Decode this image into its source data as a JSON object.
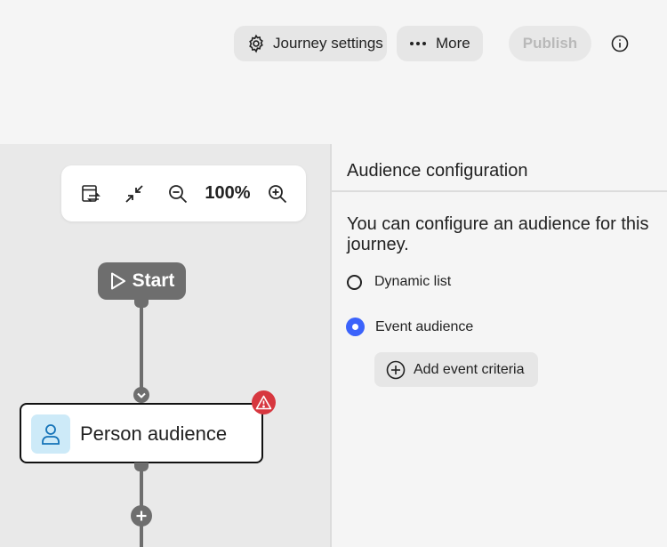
{
  "header": {
    "journey_settings_label": "Journey settings",
    "more_label": "More",
    "publish_label": "Publish",
    "icons": [
      "gear-icon",
      "ellipsis-icon",
      "info-icon"
    ]
  },
  "canvas": {
    "zoom_level": "100%",
    "toolbar_icons": [
      "switch-view-icon",
      "collapse-icon",
      "zoom-out-icon",
      "zoom-in-icon"
    ],
    "start_label": "Start",
    "node_label": "Person audience",
    "node_status": "warning",
    "colors": {
      "node_line": "#6e6e6e",
      "warning": "#d7373f",
      "node_icon_bg": "#cdeaf8"
    }
  },
  "panel": {
    "title": "Audience configuration",
    "description": "You can configure an audience for this journey.",
    "options": [
      {
        "label": "Dynamic list",
        "selected": false
      },
      {
        "label": "Event audience",
        "selected": true
      }
    ],
    "add_criteria_label": "Add event criteria",
    "colors": {
      "radio_selected": "#3b63fb"
    }
  }
}
